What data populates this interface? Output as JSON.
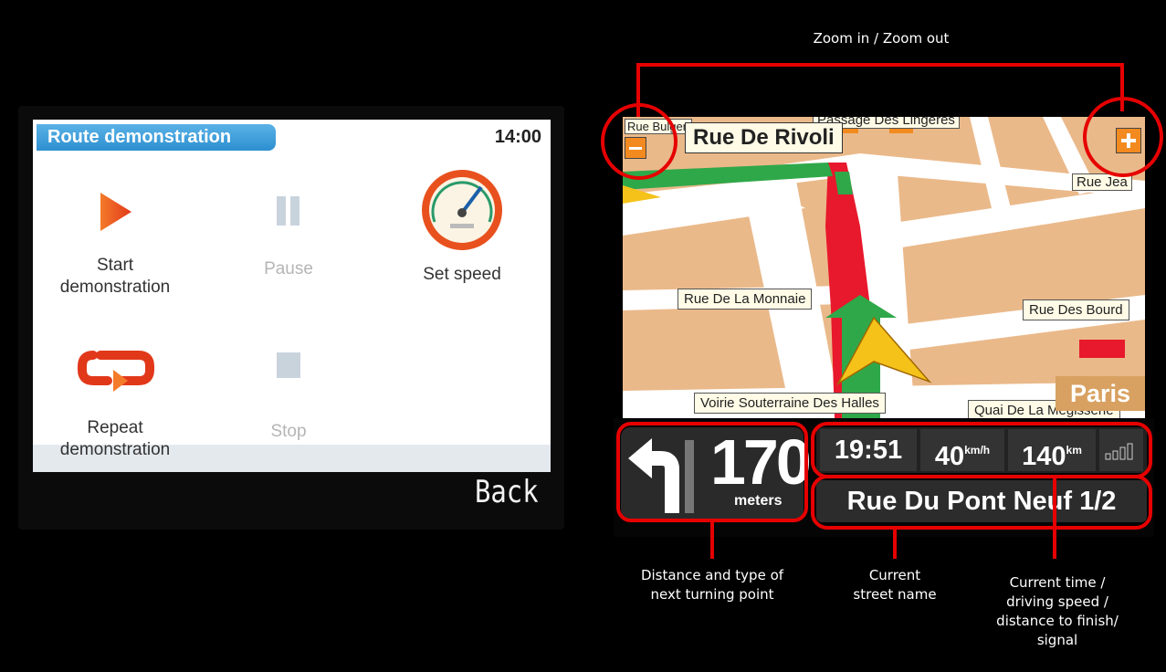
{
  "demo_menu": {
    "title": "Route demonstration",
    "time": "14:00",
    "items": [
      {
        "label": "Start\ndemonstration",
        "icon": "play-icon",
        "enabled": true
      },
      {
        "label": "Pause",
        "icon": "pause-icon",
        "enabled": false
      },
      {
        "label": "Set speed",
        "icon": "speedometer-icon",
        "enabled": true
      },
      {
        "label": "Repeat\ndemonstration",
        "icon": "repeat-icon",
        "enabled": true
      },
      {
        "label": "Stop",
        "icon": "stop-icon",
        "enabled": false
      }
    ],
    "back_label": "Back"
  },
  "map": {
    "top_street": "Rue De Rivoli",
    "street_labels": [
      "Rue De La Monnaie",
      "Rue Des Bourd",
      "Voirie Souterraine Des Halles",
      "Quai De La Mégisserie",
      "Rue Jea",
      "Passage Des Lingères",
      "Rue Bulgen"
    ],
    "city": "Paris"
  },
  "nav_panel": {
    "distance_value": "170",
    "distance_unit": "meters",
    "time": "19:51",
    "speed_value": "40",
    "speed_unit": "km/h",
    "remaining_value": "140",
    "remaining_unit": "km",
    "signal_icon": "signal-bars-icon",
    "current_street": "Rue Du Pont Neuf 1/2"
  },
  "annotations": {
    "zoom": "Zoom in / Zoom out",
    "turn": "Distance and type of\nnext turning point",
    "street": "Current\nstreet name",
    "status": "Current time /\ndriving speed /\ndistance to finish/\nsignal"
  },
  "colors": {
    "route_red": "#e8192c",
    "annotation_red": "#e60000",
    "map_base": "#eab98a",
    "menu_title_blue": "#2d8fd0",
    "icon_orange": "#e8511e"
  }
}
